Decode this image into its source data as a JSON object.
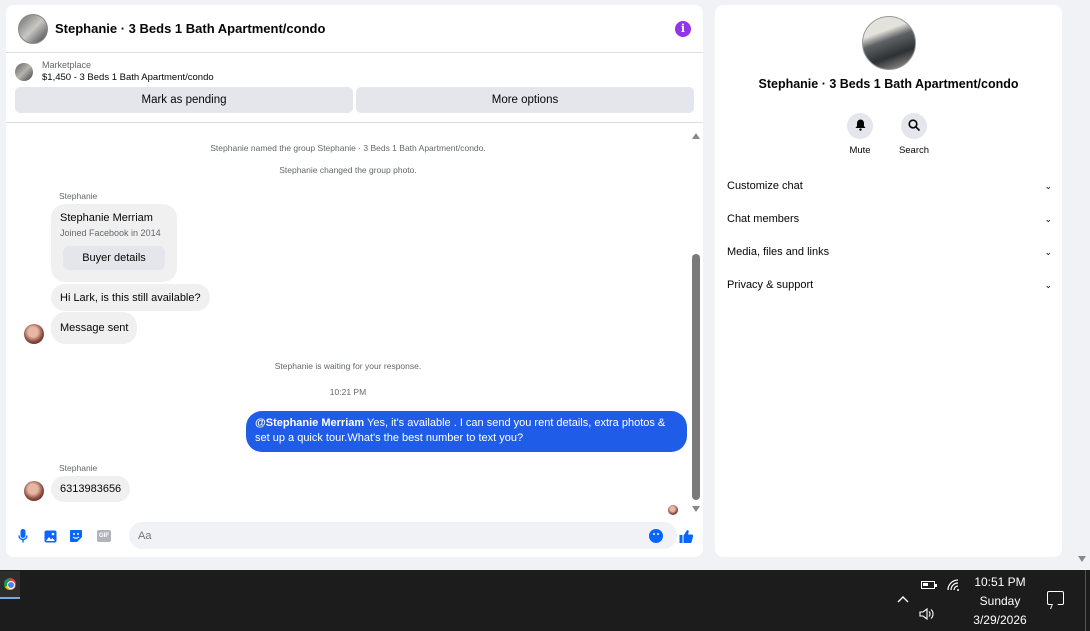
{
  "chat": {
    "title": "Stephanie · 3 Beds 1 Bath Apartment/condo",
    "info_glyph": "i",
    "marketplace": {
      "label": "Marketplace",
      "item": "$1,450 - 3 Beds 1 Bath Apartment/condo"
    },
    "actions": {
      "mark_pending": "Mark as pending",
      "more_options": "More options"
    },
    "system": {
      "named_group": "Stephanie named the group Stephanie · 3 Beds 1 Bath Apartment/condo.",
      "changed_photo": "Stephanie changed the group photo.",
      "waiting": "Stephanie is waiting for your response.",
      "timestamp": "10:21 PM"
    },
    "sender_name": "Stephanie",
    "profile_card": {
      "name": "Stephanie Merriam",
      "joined": "Joined Facebook in 2014",
      "button": "Buyer details"
    },
    "incoming": {
      "msg1": "Hi Lark, is this still available?",
      "msg2": "Message sent",
      "msg3": "6313983656"
    },
    "outgoing": {
      "mention": "@Stephanie Merriam",
      "text": " Yes, it's available .  I can send you rent details, extra photos & set up a quick tour.What's the best number to text you?"
    },
    "composer": {
      "placeholder": "Aa",
      "icons": [
        "microphone-icon",
        "image-icon",
        "sticker-icon",
        "gif-icon",
        "emoji-icon",
        "thumbs-up-icon"
      ],
      "gif_label": "GIF"
    }
  },
  "details": {
    "title": "Stephanie · 3 Beds 1 Bath Apartment/condo",
    "mute_label": "Mute",
    "search_label": "Search",
    "sections": [
      {
        "label": "Customize chat"
      },
      {
        "label": "Chat members"
      },
      {
        "label": "Media, files and links"
      },
      {
        "label": "Privacy & support"
      }
    ]
  },
  "taskbar": {
    "time": "10:51 PM",
    "day": "Sunday",
    "date": "3/29/2026"
  },
  "colors": {
    "accent": "#0866ff",
    "outgoing_bubble": "#1f5de8",
    "info_icon": "#9333ea"
  }
}
